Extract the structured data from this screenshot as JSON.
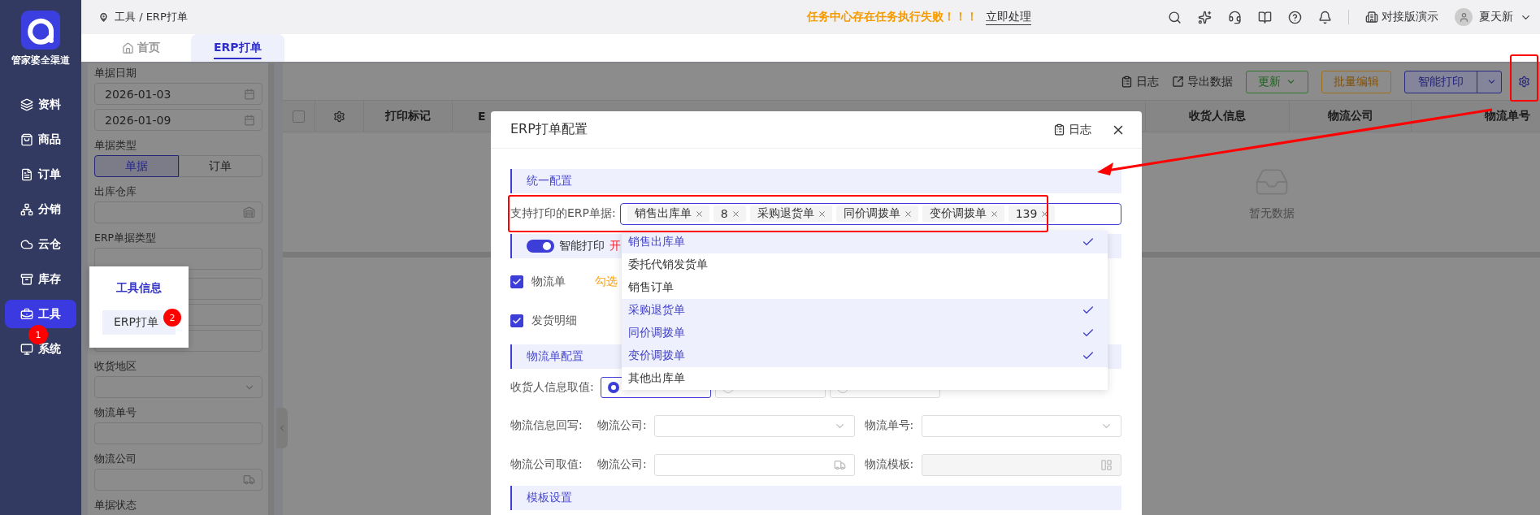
{
  "sidebar": {
    "brand": "管家婆全渠道",
    "step_badge": "1",
    "items": [
      {
        "label": "资料",
        "selected": false
      },
      {
        "label": "商品",
        "selected": false
      },
      {
        "label": "订单",
        "selected": false
      },
      {
        "label": "分销",
        "selected": false
      },
      {
        "label": "云仓",
        "selected": false
      },
      {
        "label": "库存",
        "selected": false
      },
      {
        "label": "工具",
        "selected": true
      },
      {
        "label": "系统",
        "selected": false
      }
    ]
  },
  "header": {
    "breadcrumb": "工具 / ERP打单",
    "alert": "任务中心存在任务执行失败！！！",
    "alert_action": "立即处理",
    "account": "对接版演示",
    "user": "夏天新"
  },
  "tabs": [
    {
      "label": "首页",
      "selected": false
    },
    {
      "label": "ERP打单",
      "selected": true
    }
  ],
  "filters": [
    {
      "label": "单据日期",
      "fields": [
        {
          "kind": "date",
          "value": "2026-01-03"
        },
        {
          "kind": "date",
          "value": "2026-01-09"
        }
      ]
    },
    {
      "label": "单据类型",
      "fields": [
        {
          "kind": "segmented",
          "options": [
            {
              "label": "单据",
              "selected": true
            },
            {
              "label": "订单",
              "selected": false
            }
          ]
        }
      ]
    },
    {
      "label": "出库仓库",
      "fields": [
        {
          "kind": "warehouse"
        }
      ]
    },
    {
      "label": "ERP单据类型",
      "fields": [
        {
          "kind": "text"
        }
      ]
    },
    {
      "fields": [
        {
          "kind": "text"
        },
        {
          "kind": "text"
        },
        {
          "kind": "text"
        }
      ]
    },
    {
      "label": "收货地区",
      "fields": [
        {
          "kind": "select"
        }
      ]
    },
    {
      "label": "物流单号",
      "fields": [
        {
          "kind": "text"
        }
      ]
    },
    {
      "label": "物流公司",
      "fields": [
        {
          "kind": "truck"
        }
      ]
    },
    {
      "label": "单据状态"
    }
  ],
  "popover": {
    "title": "工具信息",
    "item": "ERP打单",
    "badge": "2"
  },
  "toolbar": {
    "links": [
      "日志",
      "导出数据"
    ],
    "buttons": [
      {
        "label": "更新",
        "kind": "success-menu"
      },
      {
        "label": "批量编辑",
        "kind": "warning"
      },
      {
        "label": "智能打印",
        "kind": "primary-split"
      }
    ]
  },
  "table": {
    "select_all": {
      "checked": false
    },
    "columns": [
      "打印标记",
      "E",
      "收货人信息",
      "物流公司",
      "物流单号"
    ],
    "empty": "暂无数据"
  },
  "dialog": {
    "title": "ERP打单配置",
    "log": "日志",
    "unified": {
      "title": "统一配置",
      "label": "支持打印的ERP单据:",
      "tags": [
        "销售出库单",
        "8",
        "采购退货单",
        "同价调拨单",
        "变价调拨单",
        "139"
      ],
      "options": [
        {
          "label": "销售出库单",
          "selected": true
        },
        {
          "label": "委托代销发货单",
          "selected": false
        },
        {
          "label": "销售订单",
          "selected": false
        },
        {
          "label": "采购退货单",
          "selected": true
        },
        {
          "label": "同价调拨单",
          "selected": true
        },
        {
          "label": "变价调拨单",
          "selected": true
        },
        {
          "label": "其他出库单",
          "selected": false
        }
      ]
    },
    "smart_print": {
      "label": "智能打印",
      "on": true,
      "note": "开"
    },
    "print_options": [
      {
        "label": "物流单",
        "checked": true,
        "note": "勾选"
      },
      {
        "label": "发货明细",
        "checked": true
      }
    ],
    "logistics": {
      "title": "物流单配置",
      "consignee_label": "收货人信息取值:",
      "radios": [
        {
          "selected": true
        },
        {
          "selected": false
        },
        {
          "selected": false
        }
      ],
      "rows": [
        {
          "label": "物流信息回写:",
          "fields": [
            {
              "label": "物流公司:",
              "kind": "select"
            },
            {
              "label": "物流单号:",
              "kind": "select"
            }
          ]
        },
        {
          "label": "物流公司取值:",
          "fields": [
            {
              "label": "物流公司:",
              "kind": "truck"
            },
            {
              "label": "物流模板:",
              "kind": "template"
            }
          ]
        }
      ]
    },
    "template": {
      "title": "模板设置"
    }
  }
}
